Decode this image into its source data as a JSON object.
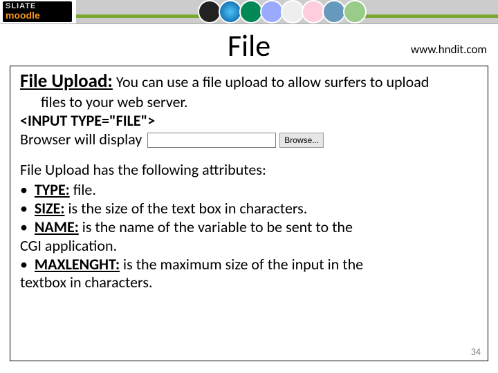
{
  "banner": {
    "logo_top": "SLIATE",
    "logo_bottom": "moodle"
  },
  "header": {
    "title": "File",
    "url": "www.hndit.com"
  },
  "content": {
    "heading": "File Upload:",
    "intro1": " You can use a file upload to allow surfers to upload",
    "intro2": "files to your web server.",
    "code": "<INPUT TYPE=\"FILE\">",
    "browser_line": "Browser will display",
    "browse_button": "Browse...",
    "file_value": "",
    "attrs_heading": "File Upload has the following attributes:",
    "attrs": [
      {
        "name": "TYPE:",
        "desc": " file."
      },
      {
        "name": "SIZE:",
        "desc": " is the size of the text box in characters."
      },
      {
        "name": "NAME:",
        "desc": " is the name of the variable to be sent to the"
      }
    ],
    "attr3_cont": "CGI application.",
    "attr4": {
      "name": "MAXLENGHT:",
      "desc": " is the maximum size of the input in the"
    },
    "attr4_cont": "textbox in characters."
  },
  "page_number": "34"
}
